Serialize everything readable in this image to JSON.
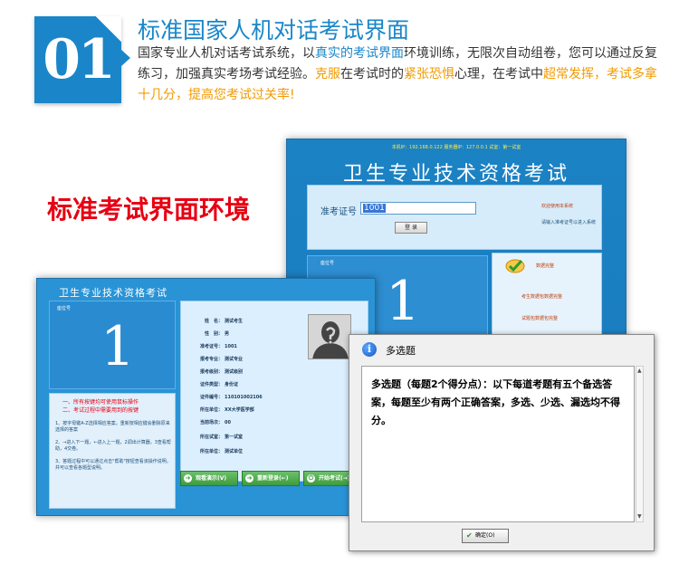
{
  "header": {
    "badge_number": "01",
    "title": "标准国家人机对话考试界面",
    "desc_1": "国家专业人机对话考试系统，以",
    "desc_hl1": "真实的考试界面",
    "desc_2": "环境训练，无限次自动组卷，您可以通过反复练习，加强真实考场考试经验。",
    "desc_hl2": "克服",
    "desc_3": "在考试时的",
    "desc_hl3": "紧张恐惧",
    "desc_4": "心理，在考试中",
    "desc_hl4": "超常发挥，考试多拿十几分，提高您考试过关率!",
    "colors": {
      "blue": "#1a86c9",
      "orange": "#f29b00",
      "red": "#e60012"
    }
  },
  "section_title": "标准考试界面环境",
  "login_window": {
    "meta": "本机IP：192.168.0.122      服务器IP：127.0.0.1      试室：第一试室",
    "title": "卫生专业技术资格考试",
    "ticket_label": "准考证号",
    "ticket_value": "1001",
    "login_button": "登 录",
    "welcome": "欢迎使用本系统",
    "hint": "请输入准考证号以进入系统",
    "seat_label": "座位号",
    "seat_number": "1",
    "right_label_1": "数据完整",
    "right_label_2": "考生数据包数据完整",
    "right_label_3": "试题包数据包完整",
    "icon": "check-icon"
  },
  "exam_window": {
    "title": "卫生专业技术资格考试",
    "seat_label": "座位号",
    "seat_number": "1",
    "notice_1": "一、所有按键均可使用鼠标操作",
    "notice_2": "二、考试过程中需要用到的按键",
    "notice_body": [
      "1、按字母键A-Z选择相应答案，重新按相应键会删除原来选择的答案",
      "2、→进入下一题，←进入上一题，2调出计算器，3查看帮助，4交卷。",
      "3、答题过程中可以通过点击\"帮助\"按钮查看该操作说明，并可以查看各题型说明。"
    ],
    "info": [
      {
        "k": "姓　名：",
        "v": "测试考生"
      },
      {
        "k": "性　别：",
        "v": "男"
      },
      {
        "k": "准考证号：",
        "v": "1001"
      },
      {
        "k": "报考专业：",
        "v": "测试专业"
      },
      {
        "k": "报考级别：",
        "v": "测试级别"
      },
      {
        "k": "证件类型：",
        "v": "身份证"
      },
      {
        "k": "证件编号：",
        "v": "110101002106"
      },
      {
        "k": "所在单位：",
        "v": "XX大学医学部"
      },
      {
        "k": "当前场次：",
        "v": "00"
      },
      {
        "k": "所在试室：",
        "v": "第一试室"
      },
      {
        "k": "所在单位：",
        "v": "测试单位"
      }
    ],
    "buttons": {
      "demo": "观看演示(V)",
      "relogin": "重新登录(←)",
      "start": "开始考试(→)"
    },
    "avatar_icon": "person-silhouette-icon"
  },
  "dialog": {
    "title": "多选题",
    "icon": "info-icon",
    "text": "多选题（每题2个得分点）：以下每道考题有五个备选答案，每题至少有两个正确答案，多选、少选、漏选均不得分。",
    "ok_button": "确定(O)"
  }
}
